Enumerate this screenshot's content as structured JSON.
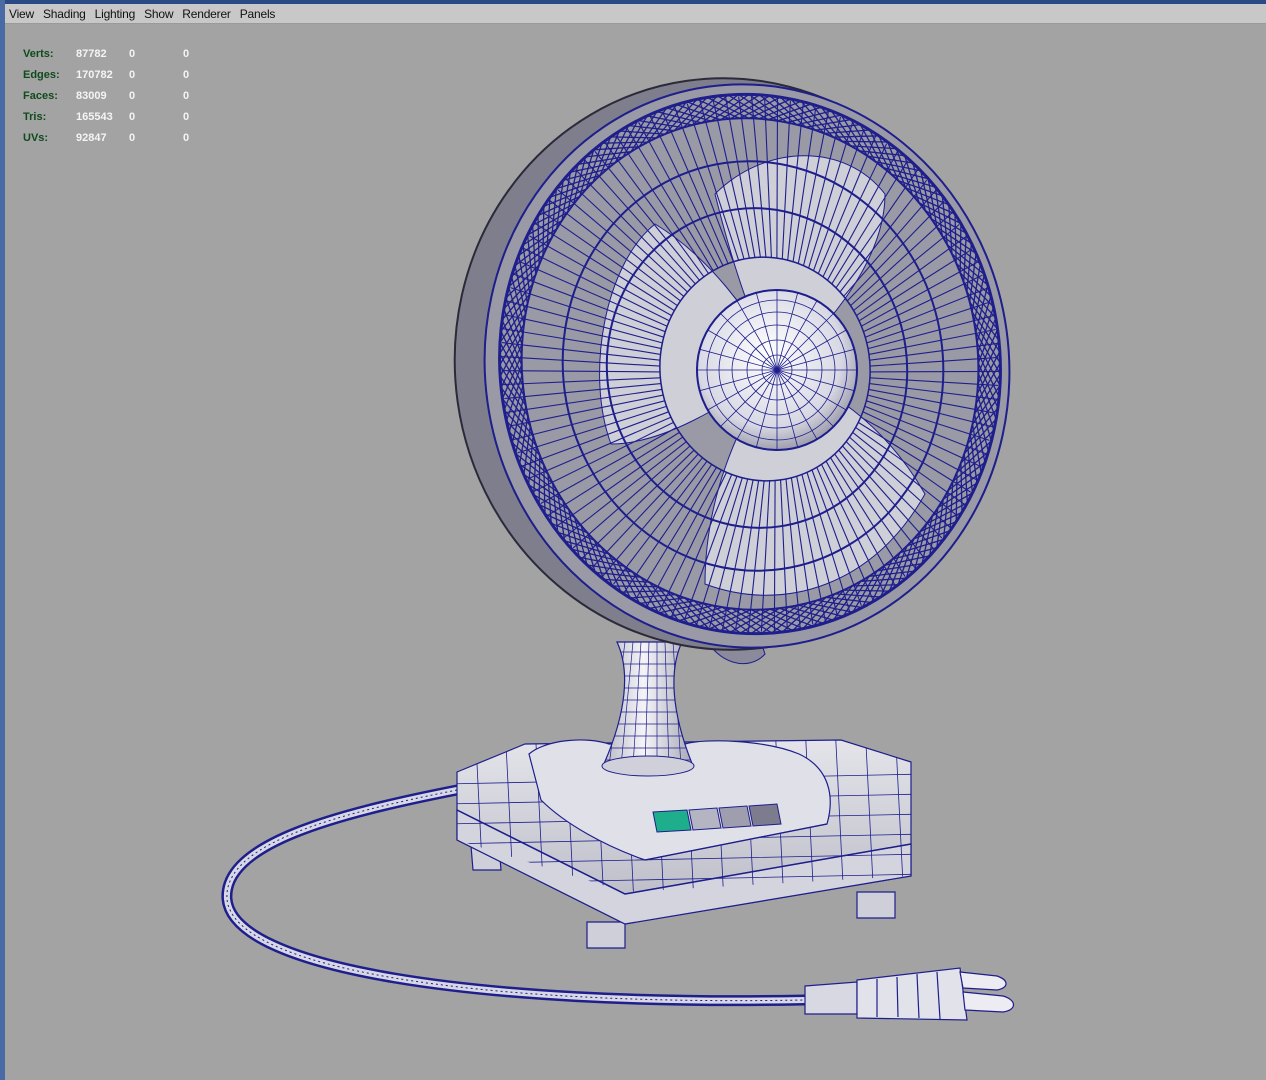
{
  "menu": [
    "View",
    "Shading",
    "Lighting",
    "Show",
    "Renderer",
    "Panels"
  ],
  "hud": [
    {
      "label": "Verts:",
      "values": [
        "87782",
        "0",
        "0"
      ]
    },
    {
      "label": "Edges:",
      "values": [
        "170782",
        "0",
        "0"
      ]
    },
    {
      "label": "Faces:",
      "values": [
        "83009",
        "0",
        "0"
      ]
    },
    {
      "label": "Tris:",
      "values": [
        "165543",
        "0",
        "0"
      ]
    },
    {
      "label": "UVs:",
      "values": [
        "92847",
        "0",
        "0"
      ]
    }
  ],
  "colors": {
    "viewport_bg": "#a3a3a3",
    "wireframe": "#1e1e8c",
    "mesh_face": "#e8e8ee",
    "hud_label": "#0f4b1c",
    "hud_value": "#f4f4f4",
    "switch_highlight": "#1fae8c"
  }
}
